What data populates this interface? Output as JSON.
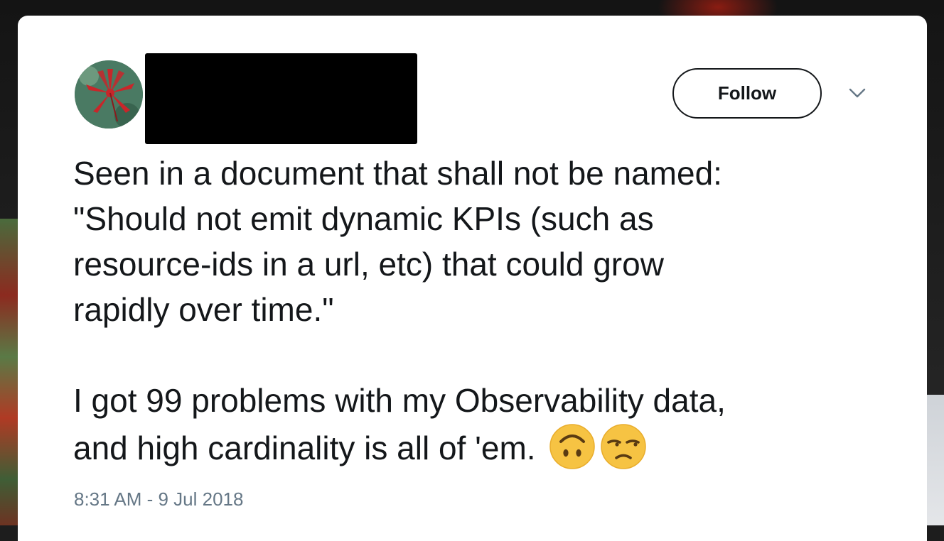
{
  "tweet": {
    "follow_label": "Follow",
    "text_lines_1": [
      "Seen in a document that shall not be named:",
      "\"Should not emit dynamic KPIs (such as",
      "resource-ids in a url, etc) that could grow",
      "rapidly over time.\""
    ],
    "text_lines_2": [
      "I got 99 problems with my Observability data,",
      "and high cardinality is all of 'em."
    ],
    "emojis": [
      "upside-down-face-emoji",
      "unamused-face-emoji"
    ],
    "timestamp": "8:31 AM - 9 Jul 2018",
    "menu_icon": "chevron-down-icon",
    "avatar_icon": "red-leaf-avatar"
  },
  "colors": {
    "text": "#14171a",
    "muted": "#657786",
    "emoji": "#f6c343"
  }
}
